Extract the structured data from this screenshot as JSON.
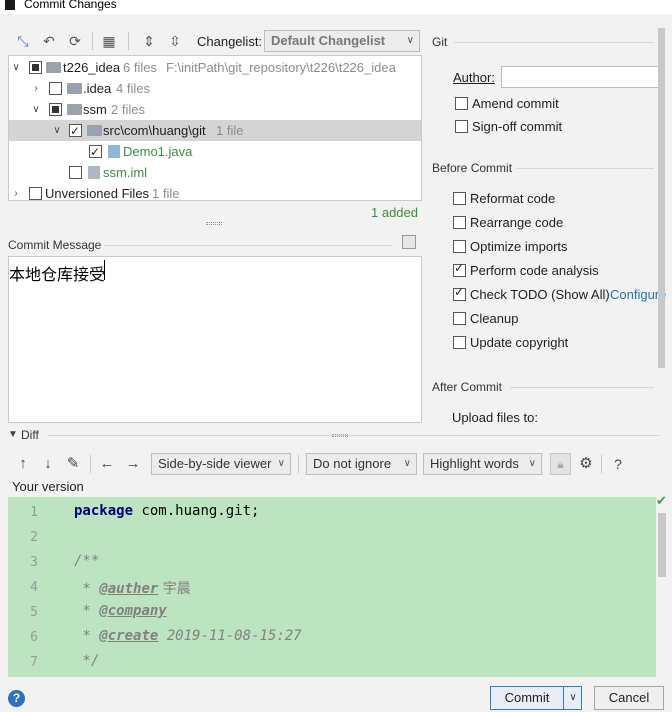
{
  "window": {
    "title": "Commit Changes"
  },
  "toolbar": {
    "icons": [
      "expand-icon",
      "undo-icon",
      "refresh-icon",
      "group-icon",
      "expand-all-icon",
      "collapse-all-icon"
    ],
    "changelist_label": "Changelist:",
    "changelist_value": "Default Changelist"
  },
  "tree": {
    "rows": [
      {
        "name": "t226_idea",
        "meta": "6 files",
        "path": "F:\\initPath\\git_repository\\t226\\t226_idea"
      },
      {
        "name": ".idea",
        "meta": "4 files"
      },
      {
        "name": "ssm",
        "meta": "2 files"
      },
      {
        "name": "src\\com\\huang\\git",
        "meta": "1 file"
      },
      {
        "name": "Demo1.java",
        "meta": ""
      },
      {
        "name": "ssm.iml",
        "meta": ""
      },
      {
        "name": "Unversioned Files",
        "meta": "1 file"
      }
    ],
    "added_status": "1 added"
  },
  "commit_message": {
    "label": "Commit Message",
    "value": "本地仓库接受"
  },
  "git_panel": {
    "section_title": "Git",
    "author_label": "Author:",
    "author_value": "",
    "amend_label": "Amend commit",
    "signoff_label": "Sign-off commit"
  },
  "before_commit": {
    "section_title": "Before Commit",
    "options": [
      {
        "label": "Reformat code",
        "checked": false
      },
      {
        "label": "Rearrange code",
        "checked": false
      },
      {
        "label": "Optimize imports",
        "checked": false
      },
      {
        "label": "Perform code analysis",
        "checked": true
      },
      {
        "label": "Check TODO (Show All)",
        "checked": true
      },
      {
        "label": "Cleanup",
        "checked": false
      },
      {
        "label": "Update copyright",
        "checked": false
      }
    ],
    "configure_link": "Configure"
  },
  "after_commit": {
    "section_title": "After Commit",
    "upload_label": "Upload files to:"
  },
  "diff": {
    "section_title": "Diff",
    "viewer_mode": "Side-by-side viewer",
    "whitespace_mode": "Do not ignore",
    "highlight_mode": "Highlight words",
    "help": "?",
    "your_version_label": "Your version",
    "lines": [
      {
        "num": "1",
        "kw": "package",
        "text": " com.huang.git;"
      },
      {
        "num": "2",
        "text": ""
      },
      {
        "num": "3",
        "comment": "/**"
      },
      {
        "num": "4",
        "comment": " * ",
        "tag": "@auther",
        "rest": " 宇晨"
      },
      {
        "num": "5",
        "comment": " * ",
        "tag": "@company",
        "rest": ""
      },
      {
        "num": "6",
        "comment": " * ",
        "tag": "@create",
        "rest": " 2019-11-08-15:27"
      },
      {
        "num": "7",
        "comment": " */"
      }
    ]
  },
  "footer": {
    "help": "?",
    "commit_label": "Commit",
    "cancel_label": "Cancel"
  },
  "colors": {
    "added_green": "#3a8d3a",
    "diff_bg": "#bde4c0",
    "link_blue": "#2470b3"
  }
}
